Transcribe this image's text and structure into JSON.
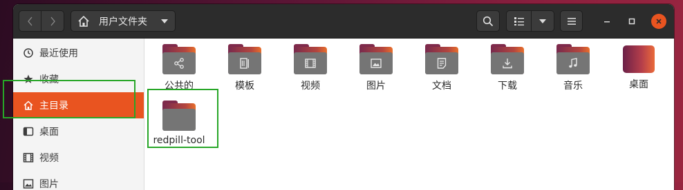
{
  "header": {
    "path_label": "用户文件夹"
  },
  "sidebar": {
    "items": [
      {
        "label": "最近使用",
        "icon": "clock-icon"
      },
      {
        "label": "收藏",
        "icon": "star-icon"
      },
      {
        "label": "主目录",
        "icon": "home-icon",
        "active": true
      },
      {
        "label": "桌面",
        "icon": "desktop-icon"
      },
      {
        "label": "视频",
        "icon": "video-icon"
      },
      {
        "label": "图片",
        "icon": "image-icon"
      }
    ]
  },
  "files": [
    {
      "name": "公共的",
      "icon": "share-icon"
    },
    {
      "name": "模板",
      "icon": "template-icon"
    },
    {
      "name": "视频",
      "icon": "video-icon"
    },
    {
      "name": "图片",
      "icon": "image-icon"
    },
    {
      "name": "文档",
      "icon": "document-icon"
    },
    {
      "name": "下载",
      "icon": "download-icon"
    },
    {
      "name": "音乐",
      "icon": "music-icon"
    },
    {
      "name": "桌面",
      "icon": "desktop-icon"
    },
    {
      "name": "redpill-tool",
      "icon": "folder-icon"
    }
  ],
  "colors": {
    "accent": "#e95420",
    "highlight": "#27a627"
  }
}
